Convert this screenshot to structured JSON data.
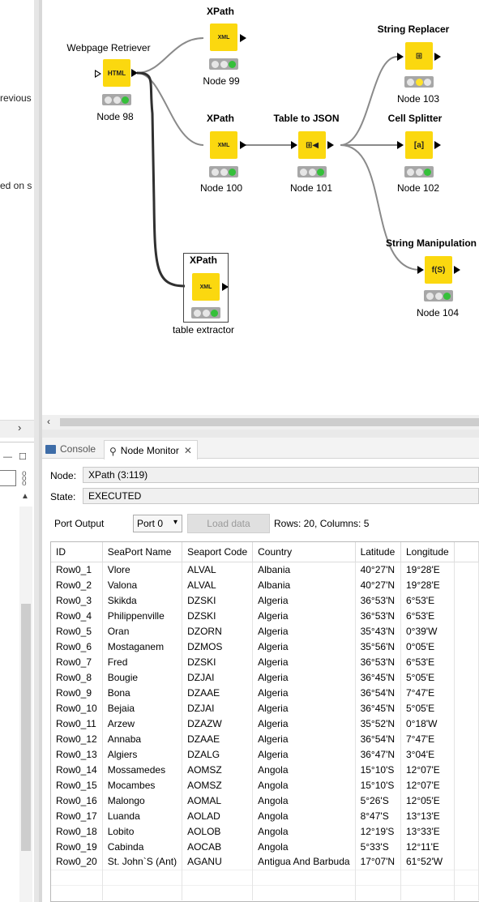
{
  "left_pane": {
    "text_lines": [
      "revious",
      "ed on s"
    ],
    "chevron": "›",
    "minimize_icon": "minimize-icon",
    "maximize_icon": "maximize-icon"
  },
  "workflow": {
    "nodes": [
      {
        "id": "n98",
        "title": "Webpage Retriever",
        "label": "Node 98",
        "icon": "HTML",
        "status": "green"
      },
      {
        "id": "n99",
        "title": "XPath",
        "label": "Node 99",
        "icon": "XML",
        "status": "green"
      },
      {
        "id": "n100",
        "title": "XPath",
        "label": "Node 100",
        "icon": "XML",
        "status": "green"
      },
      {
        "id": "n101",
        "title": "Table to JSON",
        "label": "Node 101",
        "icon": "json",
        "status": "green"
      },
      {
        "id": "n102",
        "title": "Cell Splitter",
        "label": "Node 102",
        "icon": "split",
        "status": "green"
      },
      {
        "id": "n103",
        "title": "String Replacer",
        "label": "Node 103",
        "icon": "replace",
        "status": "yellow"
      },
      {
        "id": "n104",
        "title": "String Manipulation S",
        "label": "Node 104",
        "icon": "f(S)",
        "status": "green"
      },
      {
        "id": "nte",
        "title": "XPath",
        "label": "table extractor",
        "icon": "XML",
        "status": "green"
      }
    ]
  },
  "tabs": {
    "console": "Console",
    "node_monitor": "Node Monitor",
    "close": "✕"
  },
  "monitor": {
    "node_label": "Node:",
    "node_value": "XPath  (3:119)",
    "state_label": "State:",
    "state_value": "EXECUTED",
    "port_output_label": "Port Output",
    "port_selected": "Port 0",
    "load_data": "Load data",
    "summary": "Rows: 20, Columns: 5"
  },
  "table": {
    "columns": [
      "ID",
      "SeaPort Name",
      "Seaport Code",
      "Country",
      "Latitude",
      "Longitude"
    ],
    "rows": [
      [
        "Row0_1",
        "Vlore",
        "ALVAL",
        "Albania",
        "40°27'N",
        "19°28'E"
      ],
      [
        "Row0_2",
        "Valona",
        "ALVAL",
        "Albania",
        "40°27'N",
        "19°28'E"
      ],
      [
        "Row0_3",
        "Skikda",
        "DZSKI",
        "Algeria",
        "36°53'N",
        "6°53'E"
      ],
      [
        "Row0_4",
        "Philippenville",
        "DZSKI",
        "Algeria",
        "36°53'N",
        "6°53'E"
      ],
      [
        "Row0_5",
        "Oran",
        "DZORN",
        "Algeria",
        "35°43'N",
        "0°39'W"
      ],
      [
        "Row0_6",
        "Mostaganem",
        "DZMOS",
        "Algeria",
        "35°56'N",
        "0°05'E"
      ],
      [
        "Row0_7",
        "Fred",
        "DZSKI",
        "Algeria",
        "36°53'N",
        "6°53'E"
      ],
      [
        "Row0_8",
        "Bougie",
        "DZJAI",
        "Algeria",
        "36°45'N",
        "5°05'E"
      ],
      [
        "Row0_9",
        "Bona",
        "DZAAE",
        "Algeria",
        "36°54'N",
        "7°47'E"
      ],
      [
        "Row0_10",
        "Bejaia",
        "DZJAI",
        "Algeria",
        "36°45'N",
        "5°05'E"
      ],
      [
        "Row0_11",
        "Arzew",
        "DZAZW",
        "Algeria",
        "35°52'N",
        "0°18'W"
      ],
      [
        "Row0_12",
        "Annaba",
        "DZAAE",
        "Algeria",
        "36°54'N",
        "7°47'E"
      ],
      [
        "Row0_13",
        "Algiers",
        "DZALG",
        "Algeria",
        "36°47'N",
        "3°04'E"
      ],
      [
        "Row0_14",
        "Mossamedes",
        "AOMSZ",
        "Angola",
        "15°10'S",
        "12°07'E"
      ],
      [
        "Row0_15",
        "Mocambes",
        "AOMSZ",
        "Angola",
        "15°10'S",
        "12°07'E"
      ],
      [
        "Row0_16",
        "Malongo",
        "AOMAL",
        "Angola",
        "5°26'S",
        "12°05'E"
      ],
      [
        "Row0_17",
        "Luanda",
        "AOLAD",
        "Angola",
        "8°47'S",
        "13°13'E"
      ],
      [
        "Row0_18",
        "Lobito",
        "AOLOB",
        "Angola",
        "12°19'S",
        "13°33'E"
      ],
      [
        "Row0_19",
        "Cabinda",
        "AOCAB",
        "Angola",
        "5°33'S",
        "12°11'E"
      ],
      [
        "Row0_20",
        "St. John`S (Ant)",
        "AGANU",
        "Antigua And Barbuda",
        "17°07'N",
        "61°52'W"
      ]
    ]
  }
}
